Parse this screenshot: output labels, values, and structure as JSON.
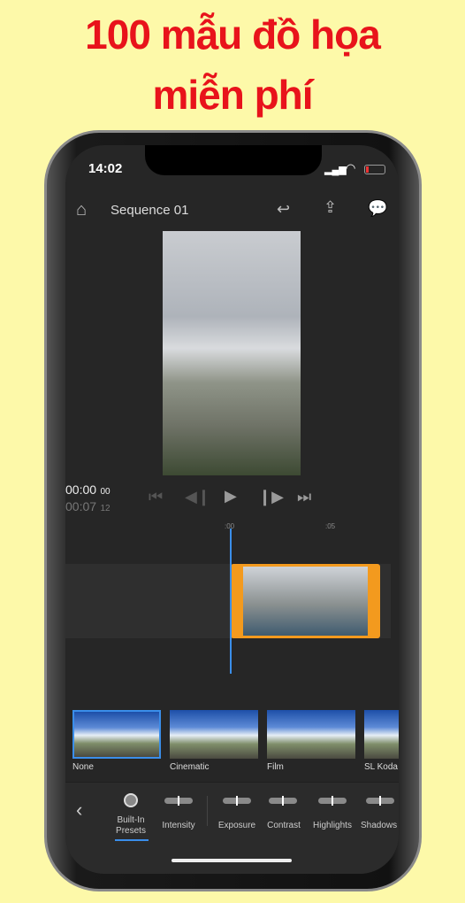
{
  "banner": {
    "line1": "100 mẫu đồ họa",
    "line2": "miễn phí"
  },
  "status": {
    "time": "14:02"
  },
  "header": {
    "title": "Sequence 01"
  },
  "timecode": {
    "current": "00:00",
    "current_frames": "00",
    "duration": "00:07",
    "duration_frames": "12"
  },
  "ruler": {
    "mark0": ":00",
    "mark1": ":05"
  },
  "presets": [
    {
      "label": "None",
      "selected": true
    },
    {
      "label": "Cinematic"
    },
    {
      "label": "Film"
    },
    {
      "label": "SL Koda"
    }
  ],
  "toolbar": {
    "built_in": "Built-In Presets",
    "intensity": "Intensity",
    "exposure": "Exposure",
    "contrast": "Contrast",
    "highlights": "Highlights",
    "shadows": "Shadows"
  },
  "colors": {
    "accent": "#3a8eea",
    "clip": "#f39a1e",
    "banner": "#e8131b"
  }
}
